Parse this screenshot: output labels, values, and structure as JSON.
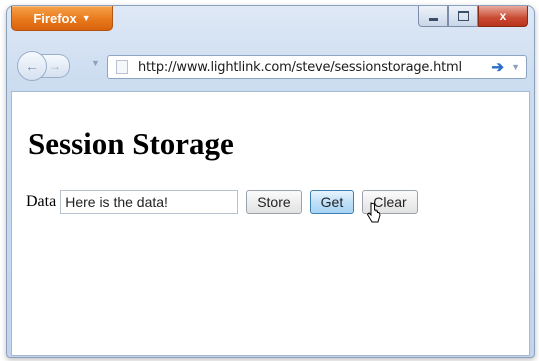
{
  "browser": {
    "menu_button_label": "Firefox",
    "address_bar": {
      "url": "http://www.lightlink.com/steve/sessionstorage.html"
    },
    "window_controls": {
      "minimize": "",
      "maximize": "",
      "close": "x"
    }
  },
  "page": {
    "heading": "Session Storage",
    "form": {
      "label": "Data",
      "input_value": "Here is the data!",
      "buttons": {
        "store": "Store",
        "get": "Get",
        "clear": "Clear"
      }
    }
  },
  "icons": [
    "firefox-menu-caret-icon",
    "back-arrow-icon",
    "forward-arrow-icon",
    "page-icon",
    "go-arrow-icon",
    "mouse-cursor-icon"
  ],
  "colors": {
    "firefox_button": "#e9791d",
    "close_button": "#c94a32",
    "hover_button": "#bfe0f7"
  }
}
